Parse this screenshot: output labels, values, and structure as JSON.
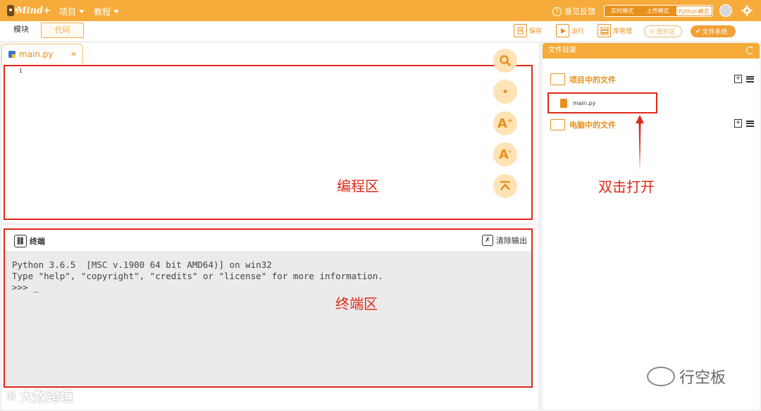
{
  "header": {
    "brand": "Mind+",
    "menus": [
      "项目",
      "教程"
    ],
    "feedback": "意见反馈",
    "modes": [
      "实时模式",
      "上传模式",
      "Python模式"
    ]
  },
  "toolbar": {
    "tabs": [
      "模块",
      "代码"
    ],
    "save": "保存",
    "run": "运行",
    "library": "库管理",
    "graphic": "图形区",
    "filesystem": "文件系统"
  },
  "editor": {
    "file_tab": "main.py",
    "close": "×",
    "line_number": "1",
    "zone_label": "编程区"
  },
  "terminal": {
    "title": "终端",
    "clear": "清除输出",
    "lines": "Python 3.6.5  [MSC v.1900 64 bit AMD64)] on win32\nType \"help\", \"copyright\", \"credits\" or \"license\" for more information.\n>>> _",
    "zone_label": "终端区"
  },
  "file_panel": {
    "title": "文件目录",
    "project_files": "项目中的文件",
    "file_name": "main.py",
    "computer_files": "电脑中的文件",
    "annotation": "双击打开"
  },
  "watermarks": {
    "wechat": "行空板",
    "bottom": "大数跨境"
  },
  "colors": {
    "accent": "#f6ab3a",
    "annotation_red": "#e0291a"
  }
}
